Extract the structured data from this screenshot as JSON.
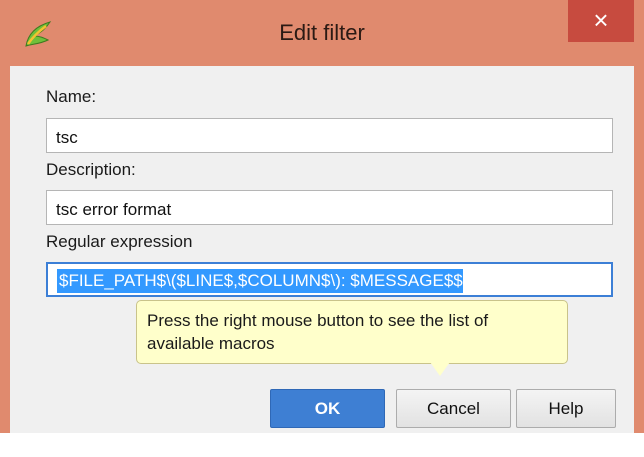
{
  "window": {
    "title": "Edit filter",
    "close_glyph": "×",
    "icon": "app-logo-icon"
  },
  "form": {
    "name_label": "Name:",
    "name_value": "tsc",
    "description_label": "Description:",
    "description_value": "tsc error format",
    "regex_label": "Regular expression",
    "regex_value": "$FILE_PATH$\\($LINE$,$COLUMN$\\): $MESSAGE$$"
  },
  "tooltip": {
    "text": "Press the right mouse button to see the list of available macros"
  },
  "buttons": {
    "ok": "OK",
    "cancel": "Cancel",
    "help": "Help"
  },
  "colors": {
    "titlebar": "#E08A6E",
    "close": "#C74B3F",
    "accent": "#3E7FD3",
    "tooltip_bg": "#FFFFCB"
  }
}
